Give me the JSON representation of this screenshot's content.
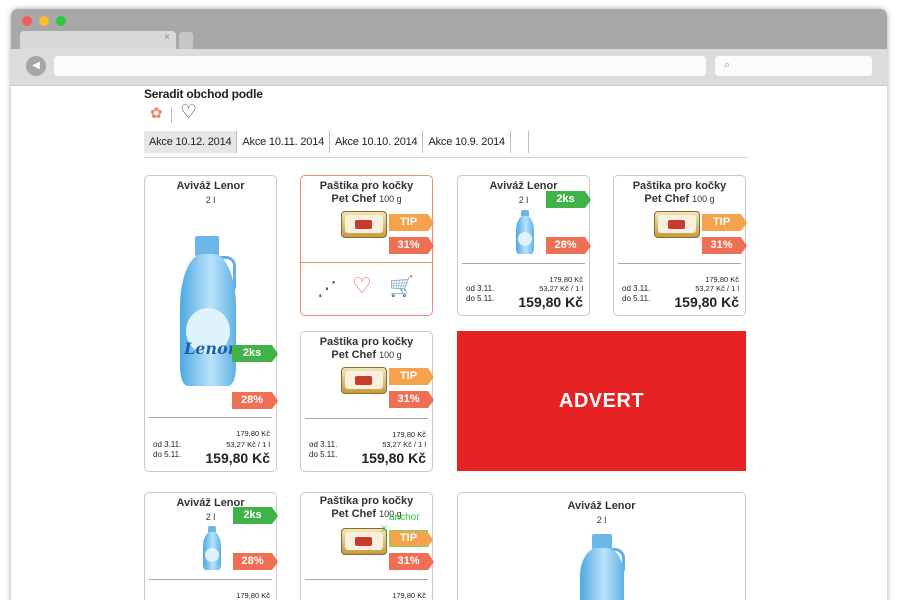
{
  "browser": {
    "traffic_lights": [
      "#f25e57",
      "#f8bf2e",
      "#2cc840"
    ],
    "tab_close": "×",
    "search_icon": "search-icon"
  },
  "sort": {
    "title": "Seradit obchod podle",
    "icons": [
      "flower-icon",
      "heart-icon"
    ]
  },
  "date_tabs": [
    {
      "label": "Akce 10.12. 2014",
      "active": true
    },
    {
      "label": "Akce 10.11. 2014",
      "active": false
    },
    {
      "label": "Akce 10.10. 2014",
      "active": false
    },
    {
      "label": "Akce 10.9. 2014",
      "active": false
    }
  ],
  "products": {
    "lenor_large": {
      "name": "Aviváž Lenor",
      "volume": "2 l",
      "badge_qty": "2ks",
      "badge_pct": "28%",
      "orig_price": "179,80 Kč",
      "unit_price": "53,27 Kč / 1 l",
      "from": "od 3.11.",
      "to": "do 5.11.",
      "price": "159,80 Kč"
    },
    "petchef_selected": {
      "name_line1": "Paštika pro kočky",
      "name_line2": "Pet Chef",
      "qty": "100 g",
      "badge_tip": "TIP",
      "badge_pct": "31%",
      "actions": [
        "share-icon",
        "heart-icon",
        "cart-icon"
      ]
    },
    "lenor_small": {
      "name": "Aviváž Lenor",
      "volume": "2 l",
      "badge_qty": "2ks",
      "badge_pct": "28%",
      "orig_price": "179,80 Kč",
      "unit_price": "53,27 Kč / 1 l",
      "from": "od 3.11.",
      "to": "do 5.11.",
      "price": "159,80 Kč"
    },
    "petchef_top_right": {
      "name_line1": "Paštika pro kočky",
      "name_line2": "Pet Chef",
      "qty": "100 g",
      "badge_tip": "TIP",
      "badge_pct": "31%",
      "orig_price": "179,80 Kč",
      "unit_price": "53,27 Kč / 1 l",
      "from": "od 3.11.",
      "to": "do 5.11.",
      "price": "159,80 Kč"
    },
    "petchef_middle": {
      "name_line1": "Paštika pro kočky",
      "name_line2": "Pet Chef",
      "qty": "100 g",
      "badge_tip": "TIP",
      "badge_pct": "31%",
      "orig_price": "179,80 Kč",
      "unit_price": "53,27 Kč / 1 l",
      "from": "od 3.11.",
      "to": "do 5.11.",
      "price": "159,80 Kč"
    },
    "lenor_bottom": {
      "name": "Aviváž Lenor",
      "volume": "2 l",
      "badge_qty": "2ks",
      "badge_pct": "28%",
      "orig_price": "179,80 Kč"
    },
    "petchef_bottom": {
      "name_line1": "Paštika pro kočky",
      "name_line2": "Pet Chef",
      "qty": "100 g",
      "badge_tip": "TIP",
      "badge_pct": "31%",
      "anchor_label": "anchor",
      "anchor_mark": "X",
      "orig_price": "179,80 Kč"
    },
    "lenor_wide": {
      "name": "Aviváž Lenor",
      "volume": "2 l"
    }
  },
  "advert": {
    "label": "ADVERT"
  },
  "colors": {
    "accent_red": "#e72222",
    "tip_orange": "#f4a24c",
    "discount_coral": "#ef6f55",
    "qty_green": "#40b348",
    "selected_border": "#f08a78"
  }
}
